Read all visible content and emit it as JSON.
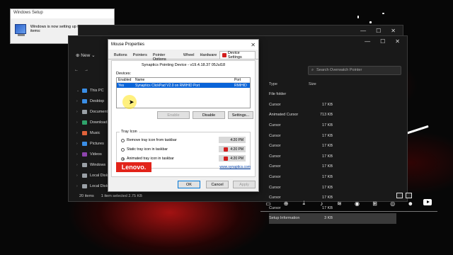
{
  "setup_popup": {
    "title": "Windows Setup",
    "message": "Windows is now setting up the following items:"
  },
  "explorer": {
    "toolbar": {
      "new_label": "New"
    },
    "search_placeholder": "Search Overwatch Pointer",
    "nav_items": [
      {
        "label": "This PC",
        "icon": "pc-icon",
        "color": "#3a8ee6"
      },
      {
        "label": "Desktop",
        "icon": "desktop-icon",
        "color": "#3a8ee6"
      },
      {
        "label": "Documents",
        "icon": "documents-icon",
        "color": "#9aa0a6"
      },
      {
        "label": "Downloads",
        "icon": "downloads-icon",
        "color": "#2fa36b"
      },
      {
        "label": "Music",
        "icon": "music-icon",
        "color": "#e0623a"
      },
      {
        "label": "Pictures",
        "icon": "pictures-icon",
        "color": "#3a8ee6"
      },
      {
        "label": "Videos",
        "icon": "videos-icon",
        "color": "#8e44ad"
      },
      {
        "label": "Windows",
        "icon": "drive-icon",
        "color": "#9aa0a6"
      },
      {
        "label": "Local Disk",
        "icon": "drive-icon",
        "color": "#9aa0a6"
      },
      {
        "label": "Local Disk",
        "icon": "drive-icon",
        "color": "#9aa0a6"
      }
    ],
    "columns": {
      "type": "Type",
      "size": "Size"
    },
    "files": [
      {
        "type": "File folder",
        "size": ""
      },
      {
        "type": "Cursor",
        "size": "17 KB"
      },
      {
        "type": "Animated Cursor",
        "size": "713 KB"
      },
      {
        "type": "Cursor",
        "size": "17 KB"
      },
      {
        "type": "Cursor",
        "size": "17 KB"
      },
      {
        "type": "Cursor",
        "size": "17 KB"
      },
      {
        "type": "Cursor",
        "size": "17 KB"
      },
      {
        "type": "Cursor",
        "size": "17 KB"
      },
      {
        "type": "Cursor",
        "size": "17 KB"
      },
      {
        "type": "Cursor",
        "size": "17 KB"
      },
      {
        "type": "Cursor",
        "size": "17 KB"
      },
      {
        "type": "Cursor",
        "size": "17 KB"
      },
      {
        "type": "Setup Information",
        "size": "3 KB",
        "selected": true
      }
    ],
    "status": {
      "item_count": "20 items",
      "selection": "1 item selected  2.75 KB"
    }
  },
  "mouse_properties": {
    "title": "Mouse Properties",
    "tabs": [
      "Buttons",
      "Pointers",
      "Pointer Options",
      "Wheel",
      "Hardware",
      "Device Settings"
    ],
    "active_tab": "Device Settings",
    "version": "Synaptics Pointing Device - v19.4.18.37 05Jul18",
    "devices_label": "Devices:",
    "device_table": {
      "headers": {
        "enabled": "Enabled",
        "name": "Name",
        "port": "Port"
      },
      "rows": [
        {
          "enabled": "Yes",
          "name": "Synaptics ClickPad V2.0 on RMIHID Port",
          "port": "RMIHID"
        }
      ]
    },
    "buttons": {
      "enable": "Enable",
      "disable": "Disable",
      "settings": "Settings...",
      "ok": "OK",
      "cancel": "Cancel",
      "apply": "Apply"
    },
    "tray": {
      "legend": "Tray Icon",
      "options": [
        {
          "label": "Remove tray icon from taskbar",
          "time": "4:20 PM",
          "selected": false
        },
        {
          "label": "Static tray icon in taskbar",
          "time": "4:20 PM",
          "selected": false
        },
        {
          "label": "Animated tray icon in taskbar",
          "time": "4:20 PM",
          "selected": true
        }
      ]
    },
    "brand": "Lenovo.",
    "link": "www.synaptics.com",
    "colors": {
      "lenovo_red": "#e2231a",
      "selection_blue": "#0a64d8"
    }
  }
}
